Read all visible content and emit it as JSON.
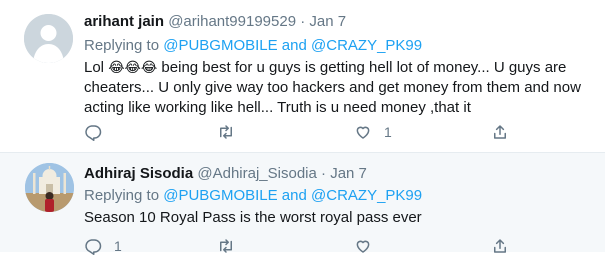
{
  "tweets": [
    {
      "name": "arihant jain",
      "handle": "@arihant99199529",
      "dot": "·",
      "date": "Jan 7",
      "replying_prefix": "Replying to ",
      "replying_user1": "@PUBGMOBILE",
      "replying_and": " and ",
      "replying_user2": "@CRAZY_PK99",
      "text_before_emoji": "Lol ",
      "emoji": "😂😂😂",
      "text_line1": " being best for u guys is getting hell lot of money...  U guys are",
      "text_line2": "cheaters... U only give way too hackers and get money from them and now",
      "text_line3": "acting like working like hell... Truth is u need money ,that it",
      "reply_count": "",
      "retweet_count": "",
      "like_count": "1"
    },
    {
      "name": "Adhiraj Sisodia",
      "handle": "@Adhiraj_Sisodia",
      "dot": "·",
      "date": "Jan 7",
      "replying_prefix": "Replying to ",
      "replying_user1": "@PUBGMOBILE",
      "replying_and": " and ",
      "replying_user2": "@CRAZY_PK99",
      "text": "Season 10 Royal Pass is the worst royal pass ever",
      "reply_count": "1",
      "retweet_count": "",
      "like_count": ""
    }
  ],
  "icons": {
    "reply": "reply-icon",
    "retweet": "retweet-icon",
    "like": "heart-icon",
    "share": "share-icon"
  },
  "colors": {
    "link": "#1da1f2",
    "secondary_text": "#657786",
    "primary_text": "#14171a",
    "highlight_bg": "#f5f8fa"
  }
}
